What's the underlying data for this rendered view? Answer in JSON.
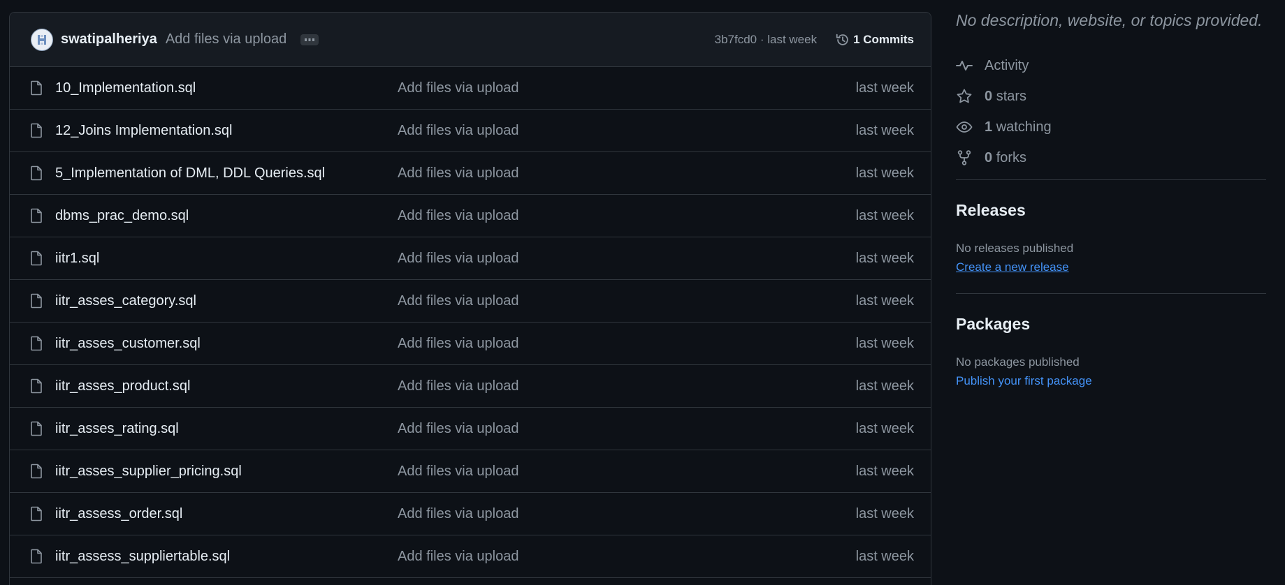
{
  "commit_bar": {
    "author": "swatipalheriya",
    "message": "Add files via upload",
    "hash_time": "3b7fcd0 · last week",
    "commits_label": "1 Commits"
  },
  "files": [
    {
      "name": "10_Implementation.sql",
      "message": "Add files via upload",
      "date": "last week"
    },
    {
      "name": "12_Joins Implementation.sql",
      "message": "Add files via upload",
      "date": "last week"
    },
    {
      "name": "5_Implementation of DML, DDL Queries.sql",
      "message": "Add files via upload",
      "date": "last week"
    },
    {
      "name": "dbms_prac_demo.sql",
      "message": "Add files via upload",
      "date": "last week"
    },
    {
      "name": "iitr1.sql",
      "message": "Add files via upload",
      "date": "last week"
    },
    {
      "name": "iitr_asses_category.sql",
      "message": "Add files via upload",
      "date": "last week"
    },
    {
      "name": "iitr_asses_customer.sql",
      "message": "Add files via upload",
      "date": "last week"
    },
    {
      "name": "iitr_asses_product.sql",
      "message": "Add files via upload",
      "date": "last week"
    },
    {
      "name": "iitr_asses_rating.sql",
      "message": "Add files via upload",
      "date": "last week"
    },
    {
      "name": "iitr_asses_supplier_pricing.sql",
      "message": "Add files via upload",
      "date": "last week"
    },
    {
      "name": "iitr_assess_order.sql",
      "message": "Add files via upload",
      "date": "last week"
    },
    {
      "name": "iitr_assess_suppliertable.sql",
      "message": "Add files via upload",
      "date": "last week"
    }
  ],
  "sidebar": {
    "description": "No description, website, or topics provided.",
    "meta": [
      {
        "icon": "pulse-icon",
        "count": "",
        "label": "Activity"
      },
      {
        "icon": "star-icon",
        "count": "0",
        "label": "stars"
      },
      {
        "icon": "eye-icon",
        "count": "1",
        "label": "watching"
      },
      {
        "icon": "fork-icon",
        "count": "0",
        "label": "forks"
      }
    ],
    "releases": {
      "title": "Releases",
      "note": "No releases published",
      "link": "Create a new release"
    },
    "packages": {
      "title": "Packages",
      "note": "No packages published",
      "link": "Publish your first package"
    }
  },
  "colors": {
    "background": "#0d1117",
    "panel_header": "#161b22",
    "border": "#30363d",
    "text_primary": "#e6edf3",
    "text_muted": "#8d96a0",
    "link": "#4493f8"
  }
}
